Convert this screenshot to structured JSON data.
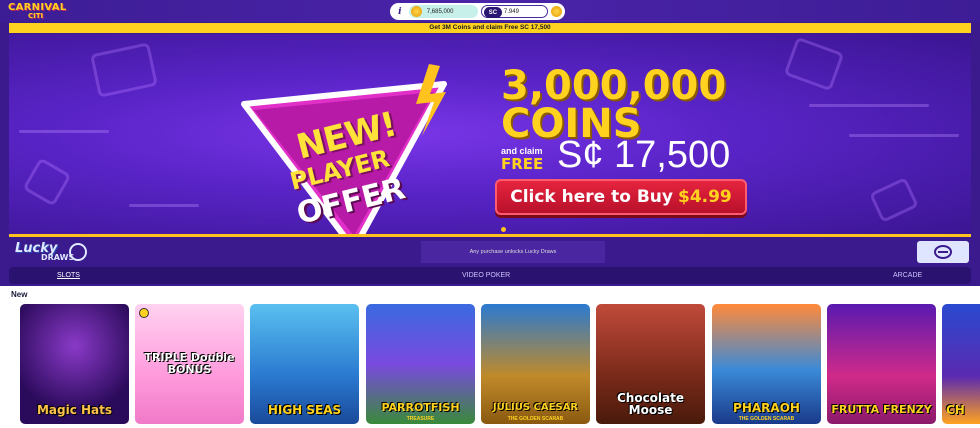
{
  "brand": {
    "line1": "CARNIVAL",
    "line2": "CITI"
  },
  "wallet": {
    "info": "i",
    "gold_coins": "7,685,000",
    "sc_label": "SC",
    "sweeps_coins": "7.949"
  },
  "promo_text": "Get 3M Coins and claim Free SC 17,500",
  "hero": {
    "badge_line1": "NEW!",
    "badge_line2": "PLAYER",
    "badge_line3": "OFFER",
    "amount": "3,000,000",
    "unit": "COINS",
    "and_claim": "and claim",
    "free": "FREE",
    "sc_amount": "S¢ 17,500",
    "cta": "Click here to Buy",
    "price": "$4.99"
  },
  "lucky": {
    "word1": "Lucky",
    "word2": "DRAWS",
    "message": "Any purchase unlocks Lucky Draws"
  },
  "tabs": [
    "SLOTS",
    "VIDEO POKER",
    "ARCADE"
  ],
  "section_title": "New",
  "games": [
    {
      "title": "Magic Hats",
      "subtitle": ""
    },
    {
      "title": "TRIPLE Double BONUS",
      "subtitle": ""
    },
    {
      "title": "HIGH SEAS",
      "subtitle": ""
    },
    {
      "title": "PARROTFISH",
      "subtitle": "TREASURE"
    },
    {
      "title": "JULIUS CAESAR",
      "subtitle": "THE GOLDEN SCARAB"
    },
    {
      "title": "Chocolate Moose",
      "subtitle": ""
    },
    {
      "title": "PHARAOH",
      "subtitle": "THE GOLDEN SCARAB"
    },
    {
      "title": "FRUTTA FRENZY",
      "subtitle": ""
    },
    {
      "title": "CH",
      "subtitle": ""
    }
  ],
  "colors": {
    "brand_purple": "#3a1a8c",
    "accent_yellow": "#ffd21f",
    "cta_red": "#d81a36"
  }
}
